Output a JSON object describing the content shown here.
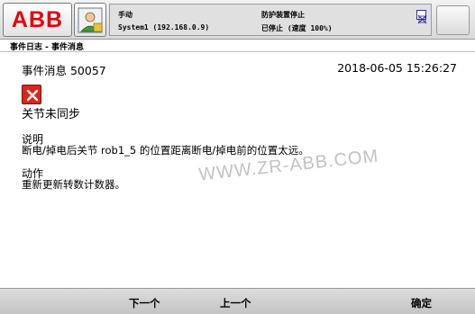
{
  "header": {
    "logo_text": "ABB",
    "mode": "手动",
    "system": "System1 (192.168.0.9)",
    "guard_status": "防护装置停止",
    "run_status": "已停止 (速度 100%)"
  },
  "tab": {
    "label": "事件日志 - 事件消息"
  },
  "event": {
    "title": "事件消息 50057",
    "timestamp": "2018-06-05 15:26:27",
    "heading": "关节未同步",
    "description_label": "说明",
    "description_text": "断电/掉电后关节 rob1_5 的位置距离断电/掉电前的位置太远。",
    "action_label": "动作",
    "action_text": "重新更新转数计数器。"
  },
  "watermark": "WWW.ZR-ABB.COM",
  "commands": {
    "next": "下一个",
    "prev": "上一个",
    "ok": "确定"
  },
  "colors": {
    "logo_red": "#e2000f",
    "error_red": "#d8261e"
  },
  "icons": {
    "user": "user-icon",
    "quickset": "quickset-icon",
    "error": "error-icon"
  }
}
